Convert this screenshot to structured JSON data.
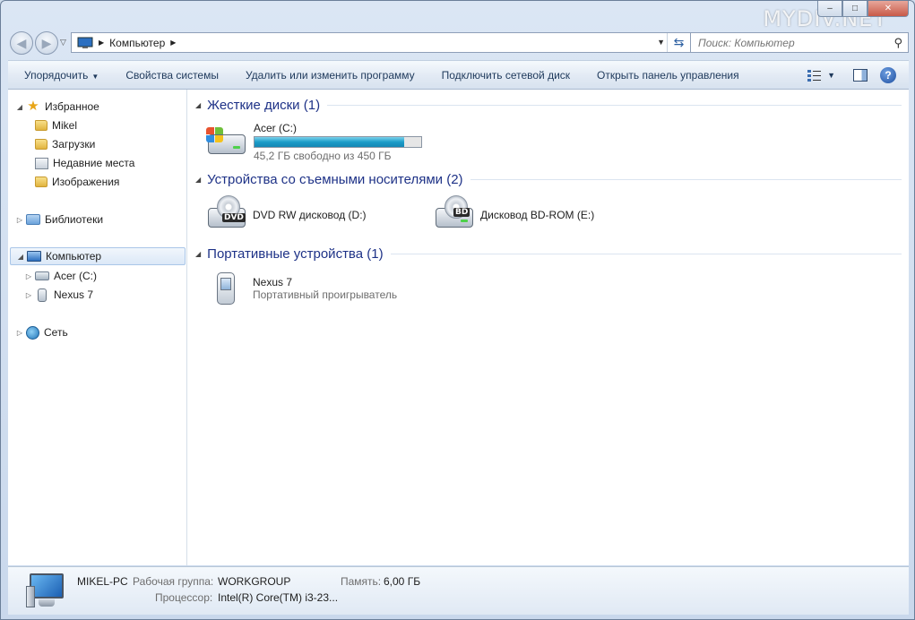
{
  "window": {
    "watermark": "MYDIV.NET",
    "caption": {
      "minimize": "–",
      "maximize": "□",
      "close": "✕"
    }
  },
  "address_bar": {
    "crumbs": [
      "Компьютер"
    ],
    "search_placeholder": "Поиск: Компьютер"
  },
  "toolbar": {
    "organize": "Упорядочить",
    "system_properties": "Свойства системы",
    "uninstall": "Удалить или изменить программу",
    "map_drive": "Подключить сетевой диск",
    "control_panel": "Открыть панель управления",
    "help": "?"
  },
  "nav": {
    "favorites": "Избранное",
    "fav_items": [
      "Mikel",
      "Загрузки",
      "Недавние места",
      "Изображения"
    ],
    "libraries": "Библиотеки",
    "computer": "Компьютер",
    "computer_items": [
      "Acer (C:)",
      "Nexus 7"
    ],
    "network": "Сеть"
  },
  "groups": {
    "hdd": "Жесткие диски (1)",
    "removable": "Устройства со съемными носителями (2)",
    "portable": "Портативные устройства (1)"
  },
  "drives": {
    "c": {
      "name": "Acer (C:)",
      "free": "45,2 ГБ свободно из 450 ГБ",
      "used_fraction": 0.9
    },
    "dvd": {
      "name": "DVD RW дисковод (D:)",
      "badge": "DVD"
    },
    "bd": {
      "name": "Дисковод BD-ROM (E:)",
      "badge": "BD"
    },
    "nexus": {
      "name": "Nexus 7",
      "type": "Портативный проигрыватель"
    }
  },
  "details": {
    "pc_name": "MIKEL-PC",
    "workgroup_label": "Рабочая группа:",
    "workgroup": "WORKGROUP",
    "memory_label": "Память:",
    "memory": "6,00 ГБ",
    "cpu_label": "Процессор:",
    "cpu": "Intel(R) Core(TM) i3-23..."
  }
}
